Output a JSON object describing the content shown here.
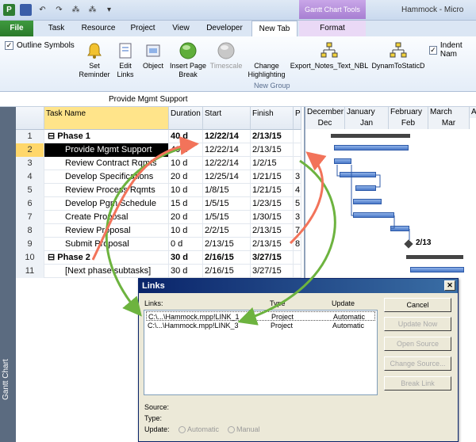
{
  "window": {
    "title": "Hammock - Micro",
    "contextual_tab_group": "Gantt Chart Tools"
  },
  "tabs": [
    {
      "label": "File"
    },
    {
      "label": "Task"
    },
    {
      "label": "Resource"
    },
    {
      "label": "Project"
    },
    {
      "label": "View"
    },
    {
      "label": "Developer"
    },
    {
      "label": "New Tab"
    },
    {
      "label": "Format"
    }
  ],
  "ribbon": {
    "outline_symbols": "Outline Symbols",
    "indent_name": "Indent Nam",
    "group_label": "New Group",
    "buttons": {
      "set_reminder": "Set Reminder",
      "edit_links": "Edit Links",
      "object": "Object",
      "insert_page_break": "Insert Page Break",
      "timescale": "Timescale",
      "change_highlighting": "Change Highlighting",
      "export_notes": "Export_Notes_Text_NBL",
      "dynam_to_static": "DynamToStaticD"
    }
  },
  "entry_bar": {
    "value": "Provide Mgmt Support"
  },
  "view_bar": {
    "label": "Gantt Chart"
  },
  "table": {
    "headers": {
      "name": "Task Name",
      "duration": "Duration",
      "start": "Start",
      "finish": "Finish",
      "predecessors": "P"
    },
    "rows": [
      {
        "id": "1",
        "name": "Phase 1",
        "duration": "40 d",
        "start": "12/22/14",
        "finish": "2/13/15",
        "pred": "",
        "summary": true
      },
      {
        "id": "2",
        "name": "Provide Mgmt Support",
        "duration": "40 d",
        "start": "12/22/14",
        "finish": "2/13/15",
        "pred": "",
        "summary": false,
        "selected": true
      },
      {
        "id": "3",
        "name": "Review Contract Rqmts",
        "duration": "10 d",
        "start": "12/22/14",
        "finish": "1/2/15",
        "pred": "",
        "summary": false
      },
      {
        "id": "4",
        "name": "Develop Specifications",
        "duration": "20 d",
        "start": "12/25/14",
        "finish": "1/21/15",
        "pred": "3",
        "summary": false
      },
      {
        "id": "5",
        "name": "Review Process Rqmts",
        "duration": "10 d",
        "start": "1/8/15",
        "finish": "1/21/15",
        "pred": "4",
        "summary": false
      },
      {
        "id": "6",
        "name": "Develop Pgm Schedule",
        "duration": "15 d",
        "start": "1/5/15",
        "finish": "1/23/15",
        "pred": "5",
        "summary": false
      },
      {
        "id": "7",
        "name": "Create Proposal",
        "duration": "20 d",
        "start": "1/5/15",
        "finish": "1/30/15",
        "pred": "3",
        "summary": false
      },
      {
        "id": "8",
        "name": "Review Proposal",
        "duration": "10 d",
        "start": "2/2/15",
        "finish": "2/13/15",
        "pred": "7",
        "summary": false
      },
      {
        "id": "9",
        "name": "Submit Proposal",
        "duration": "0 d",
        "start": "2/13/15",
        "finish": "2/13/15",
        "pred": "8",
        "summary": false
      },
      {
        "id": "10",
        "name": "Phase 2",
        "duration": "30 d",
        "start": "2/16/15",
        "finish": "3/27/15",
        "pred": "",
        "summary": true
      },
      {
        "id": "11",
        "name": "[Next phase subtasks]",
        "duration": "30 d",
        "start": "2/16/15",
        "finish": "3/27/15",
        "pred": "",
        "summary": false
      }
    ]
  },
  "gantt": {
    "top_scale": [
      "December",
      "January",
      "February",
      "March",
      "A"
    ],
    "bottom_scale": [
      "Dec",
      "Jan",
      "Feb",
      "Mar"
    ],
    "milestone_label": "2/13"
  },
  "dialog": {
    "title": "Links",
    "close": "✕",
    "col_links": "Links:",
    "col_type": "Type",
    "col_update": "Update",
    "links": [
      {
        "path": "C:\\...\\Hammock.mpp!LINK_1",
        "type": "Project",
        "update": "Automatic"
      },
      {
        "path": "C:\\...\\Hammock.mpp!LINK_3",
        "type": "Project",
        "update": "Automatic"
      }
    ],
    "buttons": {
      "cancel": "Cancel",
      "update_now": "Update Now",
      "open_source": "Open Source",
      "change_source": "Change Source...",
      "break_link": "Break Link"
    },
    "source_label": "Source:",
    "type_label": "Type:",
    "update_label": "Update:",
    "automatic": "Automatic",
    "manual": "Manual"
  },
  "colors": {
    "arrow_green": "#6db33f",
    "arrow_red": "#f2735a",
    "gantt_bar": "#4a78c8"
  }
}
